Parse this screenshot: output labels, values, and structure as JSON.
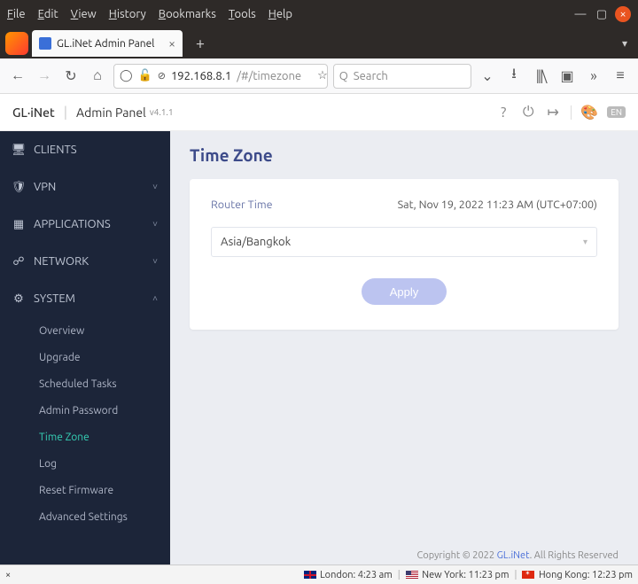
{
  "window": {
    "menus": [
      "File",
      "Edit",
      "View",
      "History",
      "Bookmarks",
      "Tools",
      "Help"
    ]
  },
  "tab": {
    "title": "GL.iNet Admin Panel"
  },
  "url": {
    "host": "192.168.8.1",
    "path": "/#/timezone"
  },
  "search": {
    "placeholder": "Search"
  },
  "header": {
    "brand": "GL·iNet",
    "title": "Admin Panel",
    "version": "v4.1.1",
    "lang": "EN"
  },
  "nav": {
    "items": [
      {
        "label": "CLIENTS",
        "icon": "clients"
      },
      {
        "label": "VPN",
        "icon": "shield",
        "chev": "down"
      },
      {
        "label": "APPLICATIONS",
        "icon": "grid",
        "chev": "down"
      },
      {
        "label": "NETWORK",
        "icon": "network",
        "chev": "down"
      },
      {
        "label": "SYSTEM",
        "icon": "gear",
        "chev": "up"
      }
    ],
    "system_sub": [
      "Overview",
      "Upgrade",
      "Scheduled Tasks",
      "Admin Password",
      "Time Zone",
      "Log",
      "Reset Firmware",
      "Advanced Settings"
    ],
    "active_sub": "Time Zone"
  },
  "page": {
    "title": "Time Zone",
    "router_time_label": "Router Time",
    "router_time_value": "Sat, Nov 19, 2022 11:23 AM (UTC+07:00)",
    "tz_selected": "Asia/Bangkok",
    "apply": "Apply"
  },
  "footer": {
    "copyright_prefix": "Copyright © 2022 ",
    "copyright_link": "GL.iNet",
    "copyright_suffix": ". All Rights Reserved"
  },
  "status": {
    "items": [
      {
        "flag": "uk",
        "city": "London",
        "time": "4:23 am"
      },
      {
        "flag": "us",
        "city": "New York",
        "time": "11:23 pm"
      },
      {
        "flag": "hk",
        "city": "Hong Kong",
        "time": "12:23 pm"
      }
    ]
  }
}
